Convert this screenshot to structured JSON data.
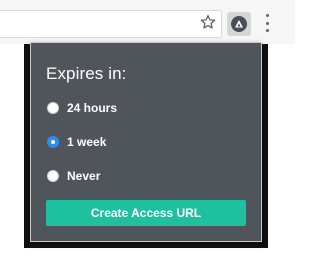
{
  "toolbar": {
    "bookmark_icon": "star-icon",
    "extension_icon": "access-logo-icon",
    "menu_icon": "vertical-dots-icon"
  },
  "popup": {
    "title": "Expires in:",
    "options": [
      {
        "label": "24 hours",
        "checked": false
      },
      {
        "label": "1 week",
        "checked": true
      },
      {
        "label": "Never",
        "checked": false
      }
    ],
    "button_label": "Create Access URL"
  },
  "colors": {
    "popup_bg": "#50555b",
    "button": "#1fc0a0",
    "radio_checked": "#2d8cf0"
  }
}
